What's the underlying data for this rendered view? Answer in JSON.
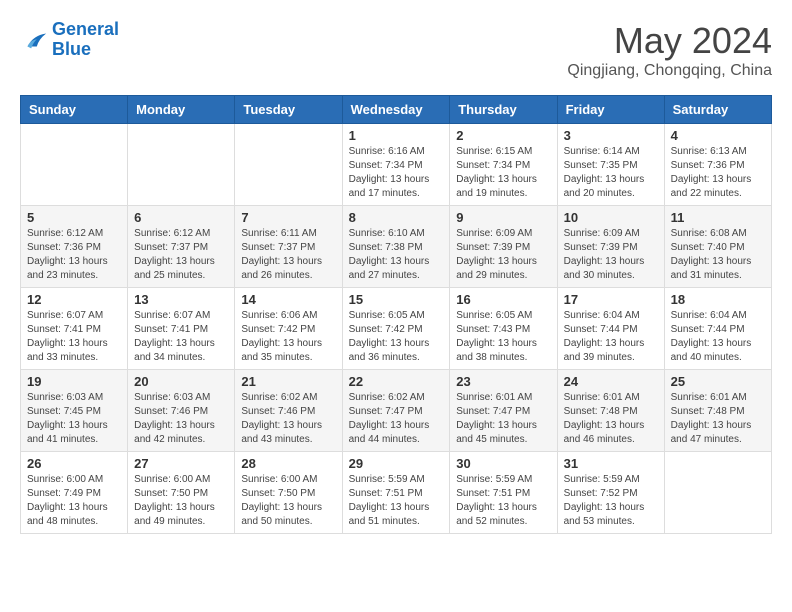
{
  "logo": {
    "line1": "General",
    "line2": "Blue"
  },
  "title": {
    "month_year": "May 2024",
    "location": "Qingjiang, Chongqing, China"
  },
  "headers": [
    "Sunday",
    "Monday",
    "Tuesday",
    "Wednesday",
    "Thursday",
    "Friday",
    "Saturday"
  ],
  "weeks": [
    [
      {
        "day": "",
        "info": ""
      },
      {
        "day": "",
        "info": ""
      },
      {
        "day": "",
        "info": ""
      },
      {
        "day": "1",
        "info": "Sunrise: 6:16 AM\nSunset: 7:34 PM\nDaylight: 13 hours\nand 17 minutes."
      },
      {
        "day": "2",
        "info": "Sunrise: 6:15 AM\nSunset: 7:34 PM\nDaylight: 13 hours\nand 19 minutes."
      },
      {
        "day": "3",
        "info": "Sunrise: 6:14 AM\nSunset: 7:35 PM\nDaylight: 13 hours\nand 20 minutes."
      },
      {
        "day": "4",
        "info": "Sunrise: 6:13 AM\nSunset: 7:36 PM\nDaylight: 13 hours\nand 22 minutes."
      }
    ],
    [
      {
        "day": "5",
        "info": "Sunrise: 6:12 AM\nSunset: 7:36 PM\nDaylight: 13 hours\nand 23 minutes."
      },
      {
        "day": "6",
        "info": "Sunrise: 6:12 AM\nSunset: 7:37 PM\nDaylight: 13 hours\nand 25 minutes."
      },
      {
        "day": "7",
        "info": "Sunrise: 6:11 AM\nSunset: 7:37 PM\nDaylight: 13 hours\nand 26 minutes."
      },
      {
        "day": "8",
        "info": "Sunrise: 6:10 AM\nSunset: 7:38 PM\nDaylight: 13 hours\nand 27 minutes."
      },
      {
        "day": "9",
        "info": "Sunrise: 6:09 AM\nSunset: 7:39 PM\nDaylight: 13 hours\nand 29 minutes."
      },
      {
        "day": "10",
        "info": "Sunrise: 6:09 AM\nSunset: 7:39 PM\nDaylight: 13 hours\nand 30 minutes."
      },
      {
        "day": "11",
        "info": "Sunrise: 6:08 AM\nSunset: 7:40 PM\nDaylight: 13 hours\nand 31 minutes."
      }
    ],
    [
      {
        "day": "12",
        "info": "Sunrise: 6:07 AM\nSunset: 7:41 PM\nDaylight: 13 hours\nand 33 minutes."
      },
      {
        "day": "13",
        "info": "Sunrise: 6:07 AM\nSunset: 7:41 PM\nDaylight: 13 hours\nand 34 minutes."
      },
      {
        "day": "14",
        "info": "Sunrise: 6:06 AM\nSunset: 7:42 PM\nDaylight: 13 hours\nand 35 minutes."
      },
      {
        "day": "15",
        "info": "Sunrise: 6:05 AM\nSunset: 7:42 PM\nDaylight: 13 hours\nand 36 minutes."
      },
      {
        "day": "16",
        "info": "Sunrise: 6:05 AM\nSunset: 7:43 PM\nDaylight: 13 hours\nand 38 minutes."
      },
      {
        "day": "17",
        "info": "Sunrise: 6:04 AM\nSunset: 7:44 PM\nDaylight: 13 hours\nand 39 minutes."
      },
      {
        "day": "18",
        "info": "Sunrise: 6:04 AM\nSunset: 7:44 PM\nDaylight: 13 hours\nand 40 minutes."
      }
    ],
    [
      {
        "day": "19",
        "info": "Sunrise: 6:03 AM\nSunset: 7:45 PM\nDaylight: 13 hours\nand 41 minutes."
      },
      {
        "day": "20",
        "info": "Sunrise: 6:03 AM\nSunset: 7:46 PM\nDaylight: 13 hours\nand 42 minutes."
      },
      {
        "day": "21",
        "info": "Sunrise: 6:02 AM\nSunset: 7:46 PM\nDaylight: 13 hours\nand 43 minutes."
      },
      {
        "day": "22",
        "info": "Sunrise: 6:02 AM\nSunset: 7:47 PM\nDaylight: 13 hours\nand 44 minutes."
      },
      {
        "day": "23",
        "info": "Sunrise: 6:01 AM\nSunset: 7:47 PM\nDaylight: 13 hours\nand 45 minutes."
      },
      {
        "day": "24",
        "info": "Sunrise: 6:01 AM\nSunset: 7:48 PM\nDaylight: 13 hours\nand 46 minutes."
      },
      {
        "day": "25",
        "info": "Sunrise: 6:01 AM\nSunset: 7:48 PM\nDaylight: 13 hours\nand 47 minutes."
      }
    ],
    [
      {
        "day": "26",
        "info": "Sunrise: 6:00 AM\nSunset: 7:49 PM\nDaylight: 13 hours\nand 48 minutes."
      },
      {
        "day": "27",
        "info": "Sunrise: 6:00 AM\nSunset: 7:50 PM\nDaylight: 13 hours\nand 49 minutes."
      },
      {
        "day": "28",
        "info": "Sunrise: 6:00 AM\nSunset: 7:50 PM\nDaylight: 13 hours\nand 50 minutes."
      },
      {
        "day": "29",
        "info": "Sunrise: 5:59 AM\nSunset: 7:51 PM\nDaylight: 13 hours\nand 51 minutes."
      },
      {
        "day": "30",
        "info": "Sunrise: 5:59 AM\nSunset: 7:51 PM\nDaylight: 13 hours\nand 52 minutes."
      },
      {
        "day": "31",
        "info": "Sunrise: 5:59 AM\nSunset: 7:52 PM\nDaylight: 13 hours\nand 53 minutes."
      },
      {
        "day": "",
        "info": ""
      }
    ]
  ]
}
